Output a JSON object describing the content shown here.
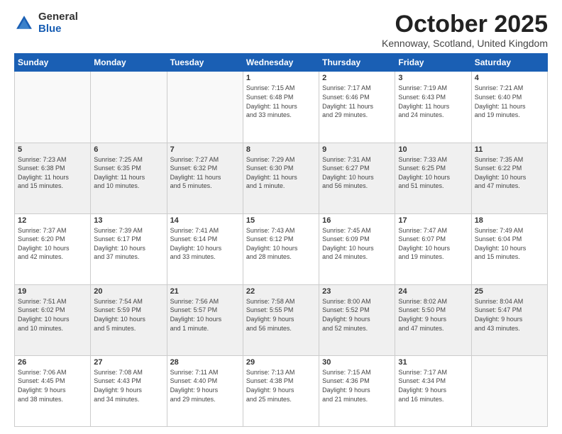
{
  "logo": {
    "general": "General",
    "blue": "Blue"
  },
  "header": {
    "month": "October 2025",
    "location": "Kennoway, Scotland, United Kingdom"
  },
  "weekdays": [
    "Sunday",
    "Monday",
    "Tuesday",
    "Wednesday",
    "Thursday",
    "Friday",
    "Saturday"
  ],
  "weeks": [
    [
      {
        "day": "",
        "info": ""
      },
      {
        "day": "",
        "info": ""
      },
      {
        "day": "",
        "info": ""
      },
      {
        "day": "1",
        "info": "Sunrise: 7:15 AM\nSunset: 6:48 PM\nDaylight: 11 hours\nand 33 minutes."
      },
      {
        "day": "2",
        "info": "Sunrise: 7:17 AM\nSunset: 6:46 PM\nDaylight: 11 hours\nand 29 minutes."
      },
      {
        "day": "3",
        "info": "Sunrise: 7:19 AM\nSunset: 6:43 PM\nDaylight: 11 hours\nand 24 minutes."
      },
      {
        "day": "4",
        "info": "Sunrise: 7:21 AM\nSunset: 6:40 PM\nDaylight: 11 hours\nand 19 minutes."
      }
    ],
    [
      {
        "day": "5",
        "info": "Sunrise: 7:23 AM\nSunset: 6:38 PM\nDaylight: 11 hours\nand 15 minutes."
      },
      {
        "day": "6",
        "info": "Sunrise: 7:25 AM\nSunset: 6:35 PM\nDaylight: 11 hours\nand 10 minutes."
      },
      {
        "day": "7",
        "info": "Sunrise: 7:27 AM\nSunset: 6:32 PM\nDaylight: 11 hours\nand 5 minutes."
      },
      {
        "day": "8",
        "info": "Sunrise: 7:29 AM\nSunset: 6:30 PM\nDaylight: 11 hours\nand 1 minute."
      },
      {
        "day": "9",
        "info": "Sunrise: 7:31 AM\nSunset: 6:27 PM\nDaylight: 10 hours\nand 56 minutes."
      },
      {
        "day": "10",
        "info": "Sunrise: 7:33 AM\nSunset: 6:25 PM\nDaylight: 10 hours\nand 51 minutes."
      },
      {
        "day": "11",
        "info": "Sunrise: 7:35 AM\nSunset: 6:22 PM\nDaylight: 10 hours\nand 47 minutes."
      }
    ],
    [
      {
        "day": "12",
        "info": "Sunrise: 7:37 AM\nSunset: 6:20 PM\nDaylight: 10 hours\nand 42 minutes."
      },
      {
        "day": "13",
        "info": "Sunrise: 7:39 AM\nSunset: 6:17 PM\nDaylight: 10 hours\nand 37 minutes."
      },
      {
        "day": "14",
        "info": "Sunrise: 7:41 AM\nSunset: 6:14 PM\nDaylight: 10 hours\nand 33 minutes."
      },
      {
        "day": "15",
        "info": "Sunrise: 7:43 AM\nSunset: 6:12 PM\nDaylight: 10 hours\nand 28 minutes."
      },
      {
        "day": "16",
        "info": "Sunrise: 7:45 AM\nSunset: 6:09 PM\nDaylight: 10 hours\nand 24 minutes."
      },
      {
        "day": "17",
        "info": "Sunrise: 7:47 AM\nSunset: 6:07 PM\nDaylight: 10 hours\nand 19 minutes."
      },
      {
        "day": "18",
        "info": "Sunrise: 7:49 AM\nSunset: 6:04 PM\nDaylight: 10 hours\nand 15 minutes."
      }
    ],
    [
      {
        "day": "19",
        "info": "Sunrise: 7:51 AM\nSunset: 6:02 PM\nDaylight: 10 hours\nand 10 minutes."
      },
      {
        "day": "20",
        "info": "Sunrise: 7:54 AM\nSunset: 5:59 PM\nDaylight: 10 hours\nand 5 minutes."
      },
      {
        "day": "21",
        "info": "Sunrise: 7:56 AM\nSunset: 5:57 PM\nDaylight: 10 hours\nand 1 minute."
      },
      {
        "day": "22",
        "info": "Sunrise: 7:58 AM\nSunset: 5:55 PM\nDaylight: 9 hours\nand 56 minutes."
      },
      {
        "day": "23",
        "info": "Sunrise: 8:00 AM\nSunset: 5:52 PM\nDaylight: 9 hours\nand 52 minutes."
      },
      {
        "day": "24",
        "info": "Sunrise: 8:02 AM\nSunset: 5:50 PM\nDaylight: 9 hours\nand 47 minutes."
      },
      {
        "day": "25",
        "info": "Sunrise: 8:04 AM\nSunset: 5:47 PM\nDaylight: 9 hours\nand 43 minutes."
      }
    ],
    [
      {
        "day": "26",
        "info": "Sunrise: 7:06 AM\nSunset: 4:45 PM\nDaylight: 9 hours\nand 38 minutes."
      },
      {
        "day": "27",
        "info": "Sunrise: 7:08 AM\nSunset: 4:43 PM\nDaylight: 9 hours\nand 34 minutes."
      },
      {
        "day": "28",
        "info": "Sunrise: 7:11 AM\nSunset: 4:40 PM\nDaylight: 9 hours\nand 29 minutes."
      },
      {
        "day": "29",
        "info": "Sunrise: 7:13 AM\nSunset: 4:38 PM\nDaylight: 9 hours\nand 25 minutes."
      },
      {
        "day": "30",
        "info": "Sunrise: 7:15 AM\nSunset: 4:36 PM\nDaylight: 9 hours\nand 21 minutes."
      },
      {
        "day": "31",
        "info": "Sunrise: 7:17 AM\nSunset: 4:34 PM\nDaylight: 9 hours\nand 16 minutes."
      },
      {
        "day": "",
        "info": ""
      }
    ]
  ]
}
